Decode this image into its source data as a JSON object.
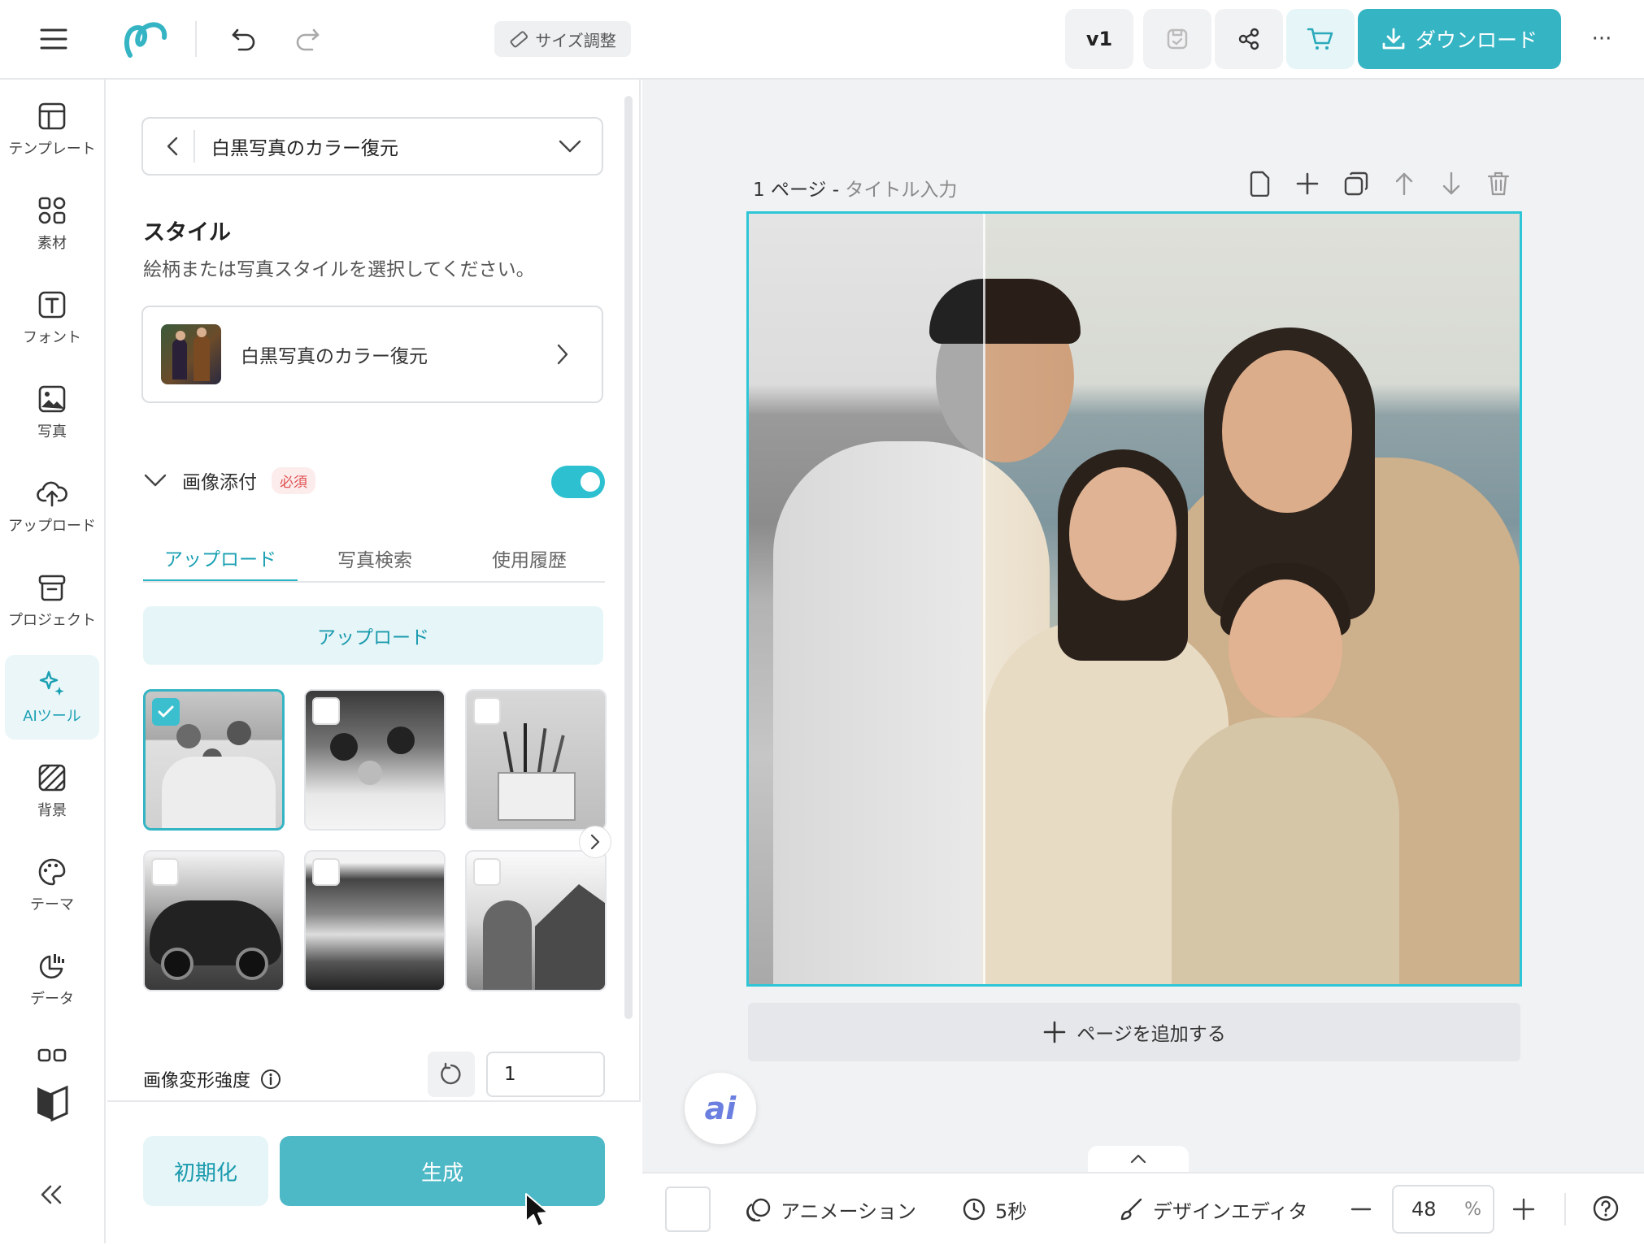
{
  "topbar": {
    "resize_label": "サイズ調整",
    "version_label": "v1",
    "download_label": "ダウンロード",
    "more_label": "···"
  },
  "rail": {
    "items": [
      {
        "label": "テンプレート",
        "icon": "template-icon"
      },
      {
        "label": "素材",
        "icon": "elements-icon"
      },
      {
        "label": "フォント",
        "icon": "font-icon"
      },
      {
        "label": "写真",
        "icon": "photo-icon"
      },
      {
        "label": "アップロード",
        "icon": "cloud-upload-icon"
      },
      {
        "label": "プロジェクト",
        "icon": "project-icon"
      },
      {
        "label": "AIツール",
        "icon": "ai-sparkle-icon",
        "active": true
      },
      {
        "label": "背景",
        "icon": "background-icon"
      },
      {
        "label": "テーマ",
        "icon": "palette-icon"
      },
      {
        "label": "データ",
        "icon": "chart-icon"
      }
    ],
    "accent_color": "#1aa0b3"
  },
  "panel": {
    "dropdown_label": "白黒写真のカラー復元",
    "style_title": "スタイル",
    "style_desc": "絵柄または写真スタイルを選択してください。",
    "style_card_label": "白黒写真のカラー復元",
    "attach_label": "画像添付",
    "required_badge": "必須",
    "toggle_on": true,
    "tabs": [
      "アップロード",
      "写真検索",
      "使用履歴"
    ],
    "active_tab": "アップロード",
    "upload_button": "アップロード",
    "strength_label": "画像変形強度",
    "strength_value": "1",
    "reset_button": "初期化",
    "generate_button": "生成"
  },
  "canvas": {
    "page_number": "1 ページ -",
    "page_title_placeholder": "タイトル入力",
    "add_page_label": "ページを追加する",
    "ai_bubble": "ai"
  },
  "bottombar": {
    "animation_label": "アニメーション",
    "duration_label": "5秒",
    "design_editor_label": "デザインエディタ",
    "zoom_value": "48",
    "zoom_unit": "%"
  },
  "colors": {
    "brand": "#35b4c4",
    "selection": "#2ec6d6",
    "required": "#e05050"
  }
}
